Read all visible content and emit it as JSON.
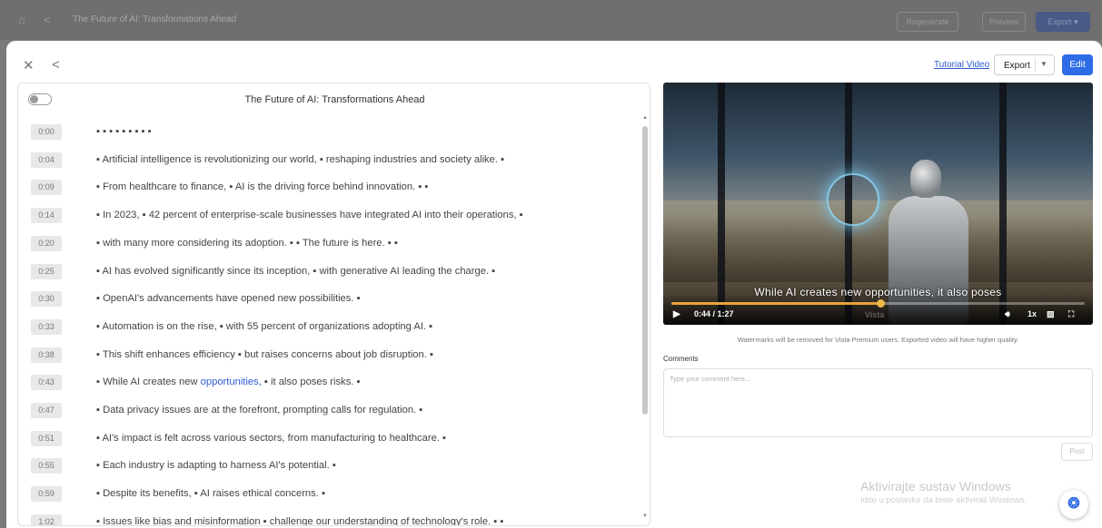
{
  "topbar": {
    "home_icon": "home-icon",
    "share_icon": "share-icon",
    "title": "The Future of AI: Transformations Ahead",
    "regenerate_label": "Regenerate",
    "preview_label": "Preview",
    "export_label": "Export"
  },
  "modal": {
    "close_icon": "close-icon",
    "share_icon": "share-icon",
    "tutorial_link": "Tutorial Video",
    "export_label": "Export",
    "edit_label": "Edit"
  },
  "transcript": {
    "title": "The Future of AI: Transformations Ahead",
    "toggle_on": false,
    "rows": [
      {
        "time": "0:00",
        "text": "▪ ▪ ▪ ▪ ▪ ▪ ▪ ▪ ▪"
      },
      {
        "time": "0:04",
        "text": "▪ Artificial intelligence is revolutionizing our world, ▪ reshaping industries and society alike. ▪"
      },
      {
        "time": "0:09",
        "text": "▪ From healthcare to finance, ▪ AI is the driving force behind innovation. ▪ ▪"
      },
      {
        "time": "0:14",
        "text": "▪ In 2023, ▪ 42 percent of enterprise-scale businesses have integrated AI into their operations, ▪"
      },
      {
        "time": "0:20",
        "text": "▪ with many more considering its adoption. ▪ ▪ The future is here. ▪ ▪"
      },
      {
        "time": "0:25",
        "text": "▪ AI has evolved significantly since its inception, ▪ with generative AI leading the charge. ▪"
      },
      {
        "time": "0:30",
        "text": "▪ OpenAI's advancements have opened new possibilities. ▪"
      },
      {
        "time": "0:33",
        "text": "▪ Automation is on the rise, ▪ with 55 percent of organizations adopting AI. ▪"
      },
      {
        "time": "0:38",
        "text": "▪ This shift enhances efficiency ▪ but raises concerns about job disruption. ▪"
      },
      {
        "time": "0:43",
        "text_before": "▪ While AI creates new ",
        "highlight": "opportunities,",
        "text_after": " ▪ it also poses risks. ▪"
      },
      {
        "time": "0:47",
        "text": "▪ Data privacy issues are at the forefront, prompting calls for regulation. ▪"
      },
      {
        "time": "0:51",
        "text": "▪ AI's impact is felt across various sectors, from manufacturing to healthcare. ▪"
      },
      {
        "time": "0:55",
        "text": "▪ Each industry is adapting to harness AI's potential. ▪"
      },
      {
        "time": "0:59",
        "text": "▪ Despite its benefits, ▪ AI raises ethical concerns. ▪"
      },
      {
        "time": "1:02",
        "text": "▪ Issues like bias and misinformation ▪ challenge our understanding of technology's role. ▪ ▪"
      }
    ]
  },
  "video": {
    "caption": "While AI creates new opportunities, it also poses",
    "time": "0:44 / 1:27",
    "progress": 0.506,
    "watermark": "Vista",
    "speed": "1x",
    "accent_color": "#e8a33a"
  },
  "watermark_note": "Watermarks will be removed for Vista Premium users. Exported video will have higher quality.",
  "comments": {
    "label": "Comments",
    "placeholder": "Type your comment here...",
    "post_label": "Post"
  },
  "windows_activation": {
    "line1": "Aktivirajte sustav Windows",
    "line2": "Idite u postavke da biste aktivirali Windows."
  }
}
